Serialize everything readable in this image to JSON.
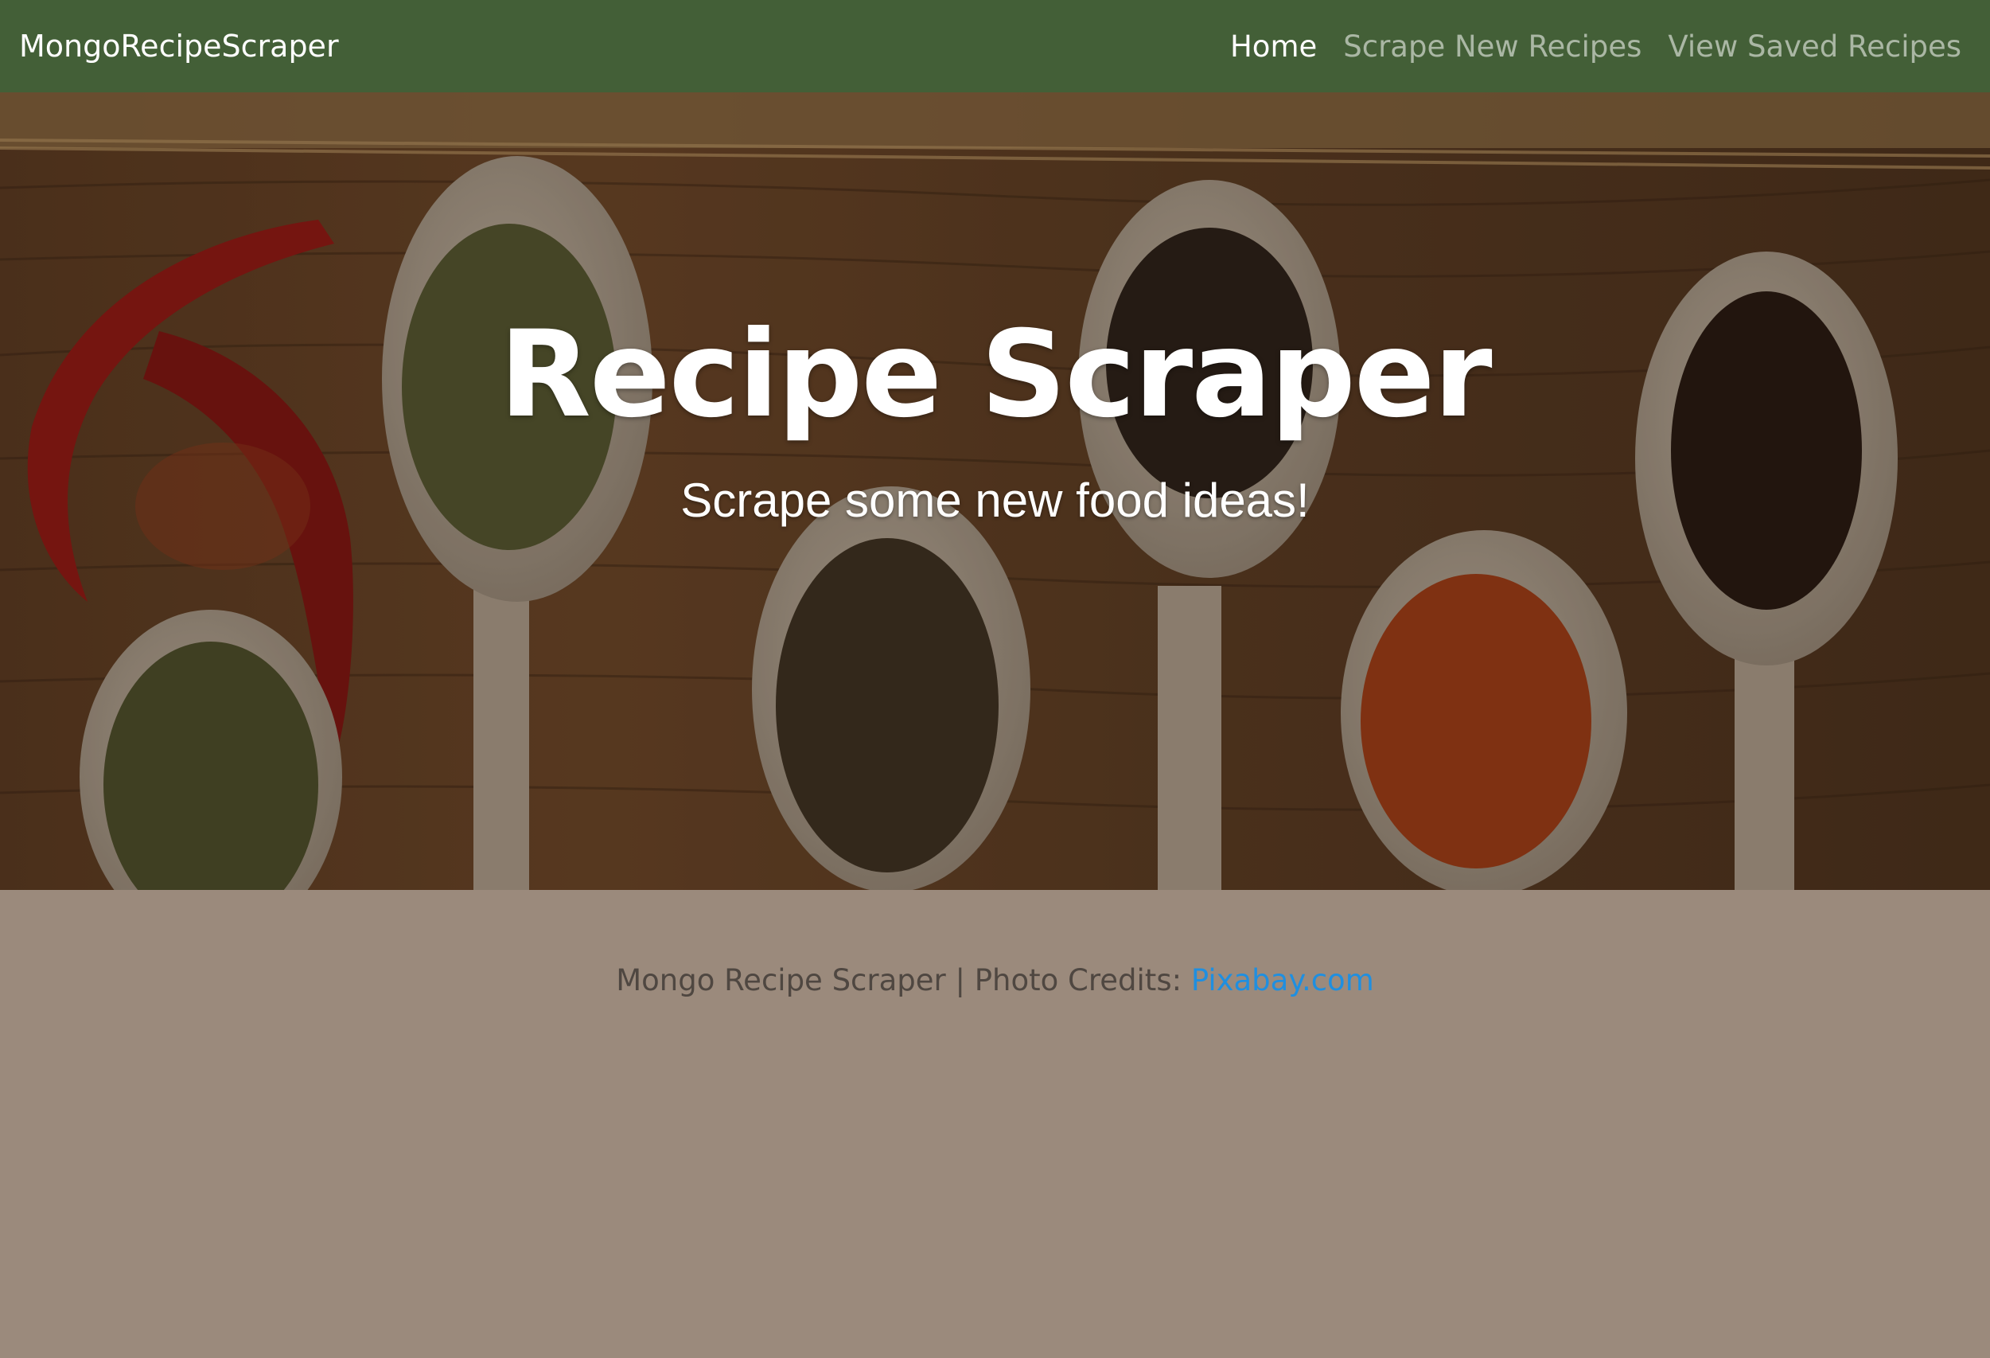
{
  "navbar": {
    "brand": "MongoRecipeScraper",
    "links": [
      {
        "label": "Home",
        "active": true
      },
      {
        "label": "Scrape New Recipes",
        "active": false
      },
      {
        "label": "View Saved Recipes",
        "active": false
      }
    ]
  },
  "hero": {
    "title": "Recipe Scraper",
    "subtitle": "Scrape some new food ideas!"
  },
  "footer": {
    "text": "Mongo Recipe Scraper | Photo Credits: ",
    "link_label": "Pixabay.com"
  },
  "colors": {
    "navbar_bg": "#435f37",
    "page_bg": "#9b8a7c",
    "link": "#1f8fe0"
  }
}
